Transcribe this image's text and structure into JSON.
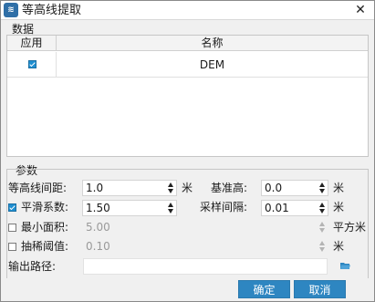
{
  "window": {
    "title": "等高线提取",
    "icon": "contour-app-icon",
    "close_glyph": "✕"
  },
  "data_group": {
    "label": "数据",
    "columns": [
      "应用",
      "名称"
    ],
    "rows": [
      {
        "checked": true,
        "name": "DEM"
      }
    ]
  },
  "params_group": {
    "label": "参数",
    "interval": {
      "label": "等高线间距:",
      "value": "1.0",
      "unit": "米"
    },
    "base_height": {
      "label": "基准高:",
      "value": "0.0",
      "unit": "米"
    },
    "smooth": {
      "label": "平滑系数:",
      "checked": true,
      "value": "1.50"
    },
    "sample": {
      "label": "采样间隔:",
      "value": "0.01",
      "unit": "米"
    },
    "min_area": {
      "label": "最小面积:",
      "checked": false,
      "value": "5.00",
      "unit": "平方米"
    },
    "thin": {
      "label": "抽稀阈值:",
      "checked": false,
      "value": "0.10",
      "unit": "米"
    },
    "output": {
      "label": "输出路径:",
      "value": ""
    }
  },
  "buttons": {
    "ok": "确定",
    "cancel": "取消"
  },
  "colors": {
    "accent": "#2e86c1",
    "checkbox": "#1f8fd1"
  }
}
